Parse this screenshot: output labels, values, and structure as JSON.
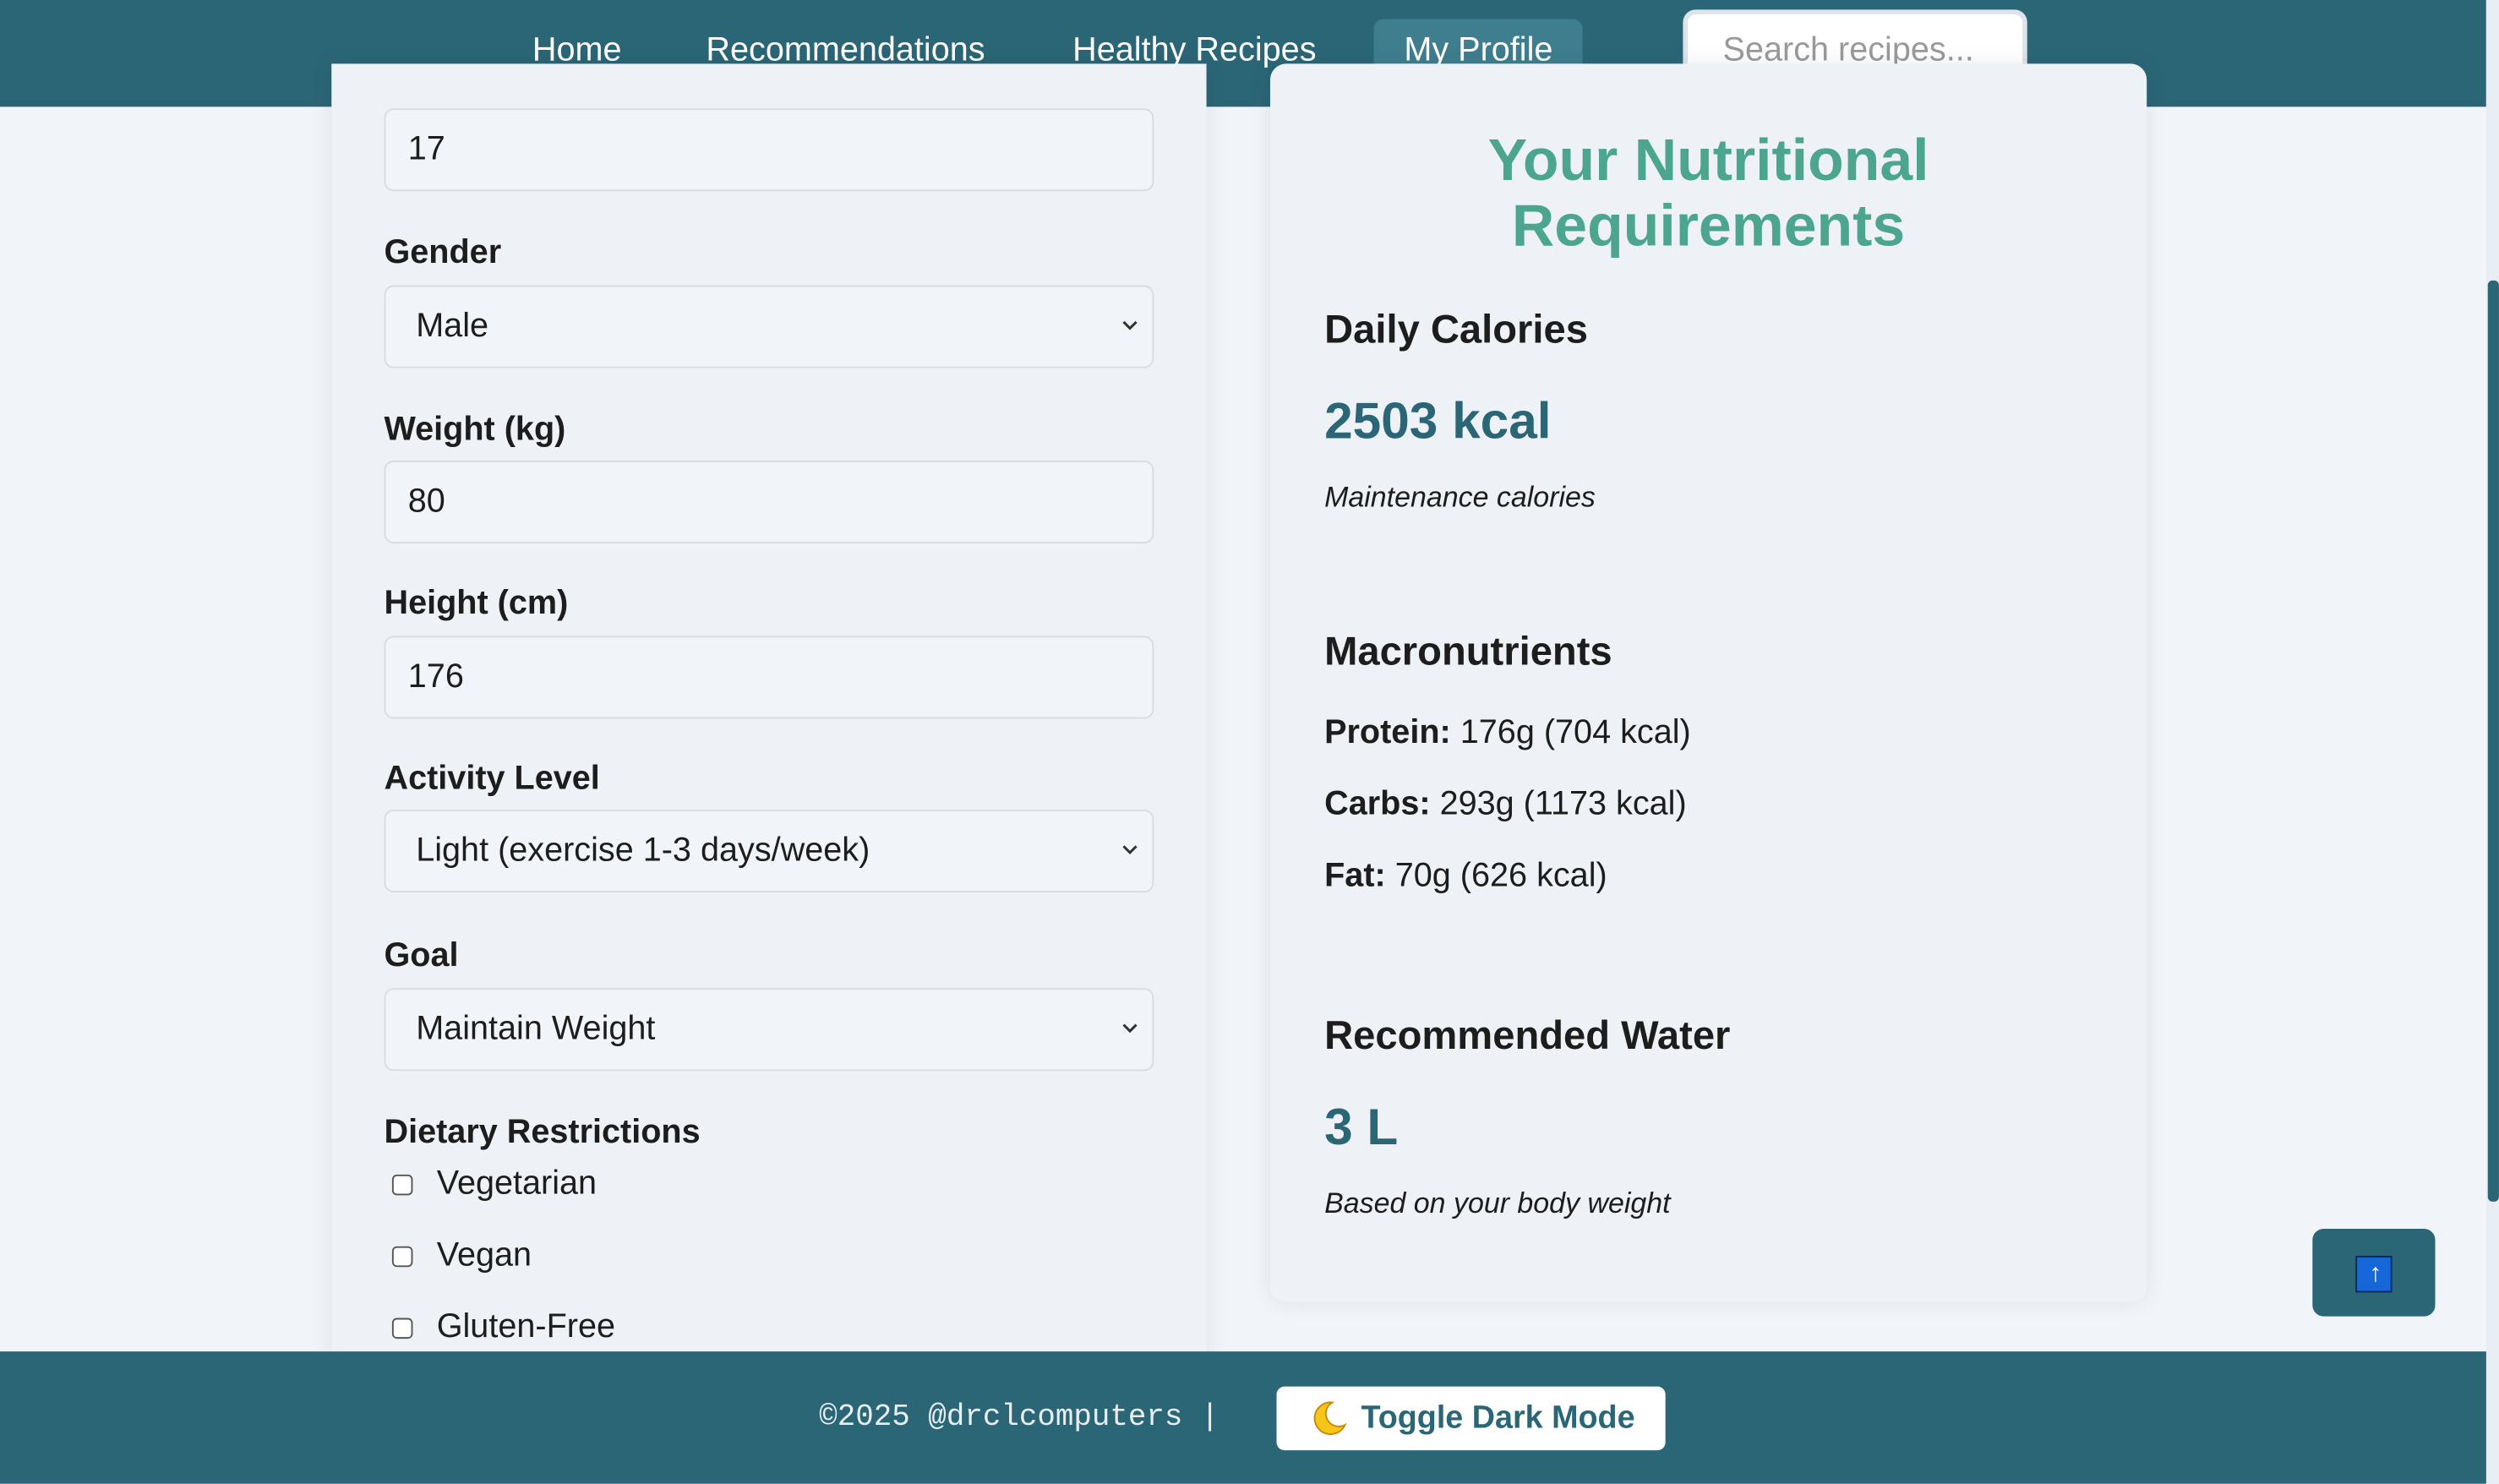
{
  "nav": {
    "items": [
      {
        "label": "Home"
      },
      {
        "label": "Recommendations"
      },
      {
        "label": "Healthy Recipes"
      },
      {
        "label": "My Profile",
        "active": true
      }
    ],
    "search_placeholder": "Search recipes..."
  },
  "form": {
    "age_value": "17",
    "gender": {
      "label": "Gender",
      "value": "Male"
    },
    "weight": {
      "label": "Weight (kg)",
      "value": "80"
    },
    "height": {
      "label": "Height (cm)",
      "value": "176"
    },
    "activity": {
      "label": "Activity Level",
      "value": "Light (exercise 1-3 days/week)"
    },
    "goal": {
      "label": "Goal",
      "value": "Maintain Weight"
    },
    "dietary": {
      "label": "Dietary Restrictions",
      "options": [
        {
          "label": "Vegetarian",
          "checked": false
        },
        {
          "label": "Vegan",
          "checked": false
        },
        {
          "label": "Gluten-Free",
          "checked": false
        }
      ]
    }
  },
  "requirements": {
    "title_line1": "Your Nutritional",
    "title_line2": "Requirements",
    "calories": {
      "heading": "Daily Calories",
      "value": "2503 kcal",
      "note": "Maintenance calories"
    },
    "macros": {
      "heading": "Macronutrients",
      "items": [
        {
          "name": "Protein:",
          "value": "176g (704 kcal)"
        },
        {
          "name": "Carbs:",
          "value": "293g (1173 kcal)"
        },
        {
          "name": "Fat:",
          "value": "70g (626 kcal)"
        }
      ]
    },
    "water": {
      "heading": "Recommended Water",
      "value": "3 L",
      "note": "Based on your body weight"
    }
  },
  "back_to_top": {
    "symbol": "↑"
  },
  "footer": {
    "copyright": "©2025 @drclcomputers |",
    "dark_mode_label": "Toggle Dark Mode",
    "dark_mode_icon": "moon-icon"
  },
  "colors": {
    "primary": "#2b6677",
    "accent": "#4ca58e",
    "background": "#f1f4f8"
  }
}
